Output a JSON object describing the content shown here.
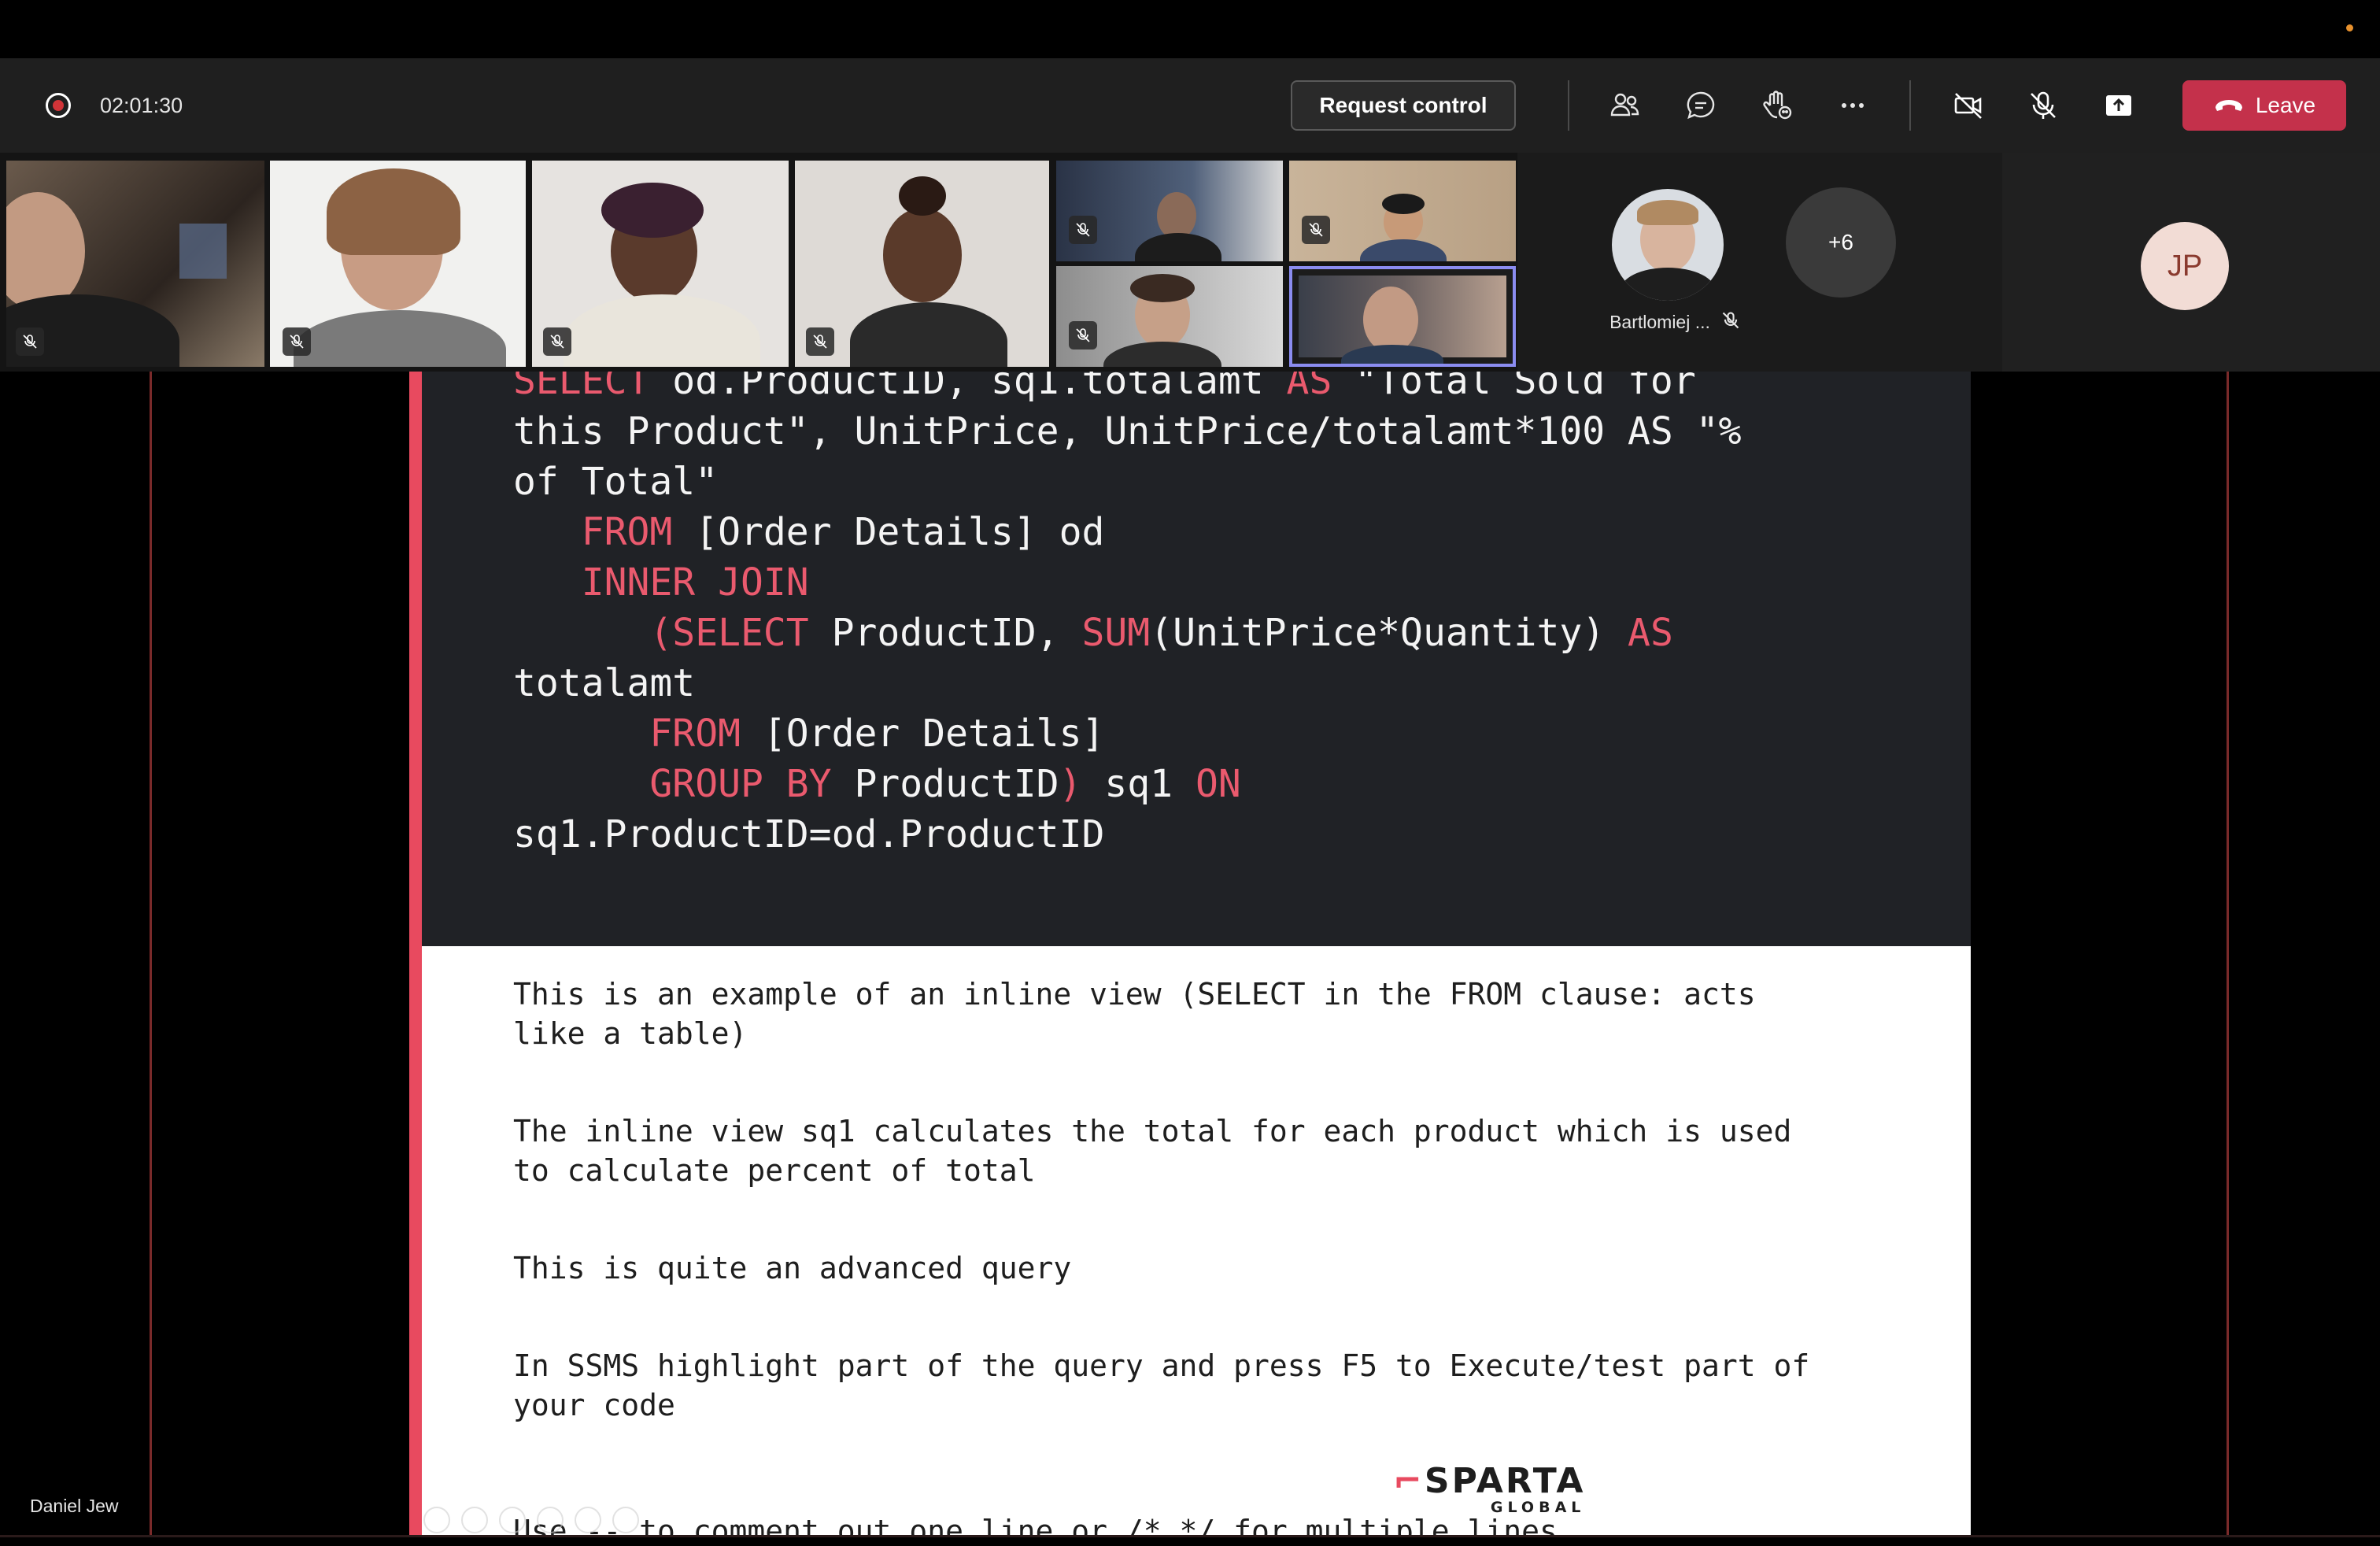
{
  "meeting": {
    "timer": "02:01:30",
    "request_control_label": "Request control",
    "leave_label": "Leave",
    "more_participants": "+6",
    "jp_initials": "JP",
    "bartlomiej_name": "Bartlomiej ...",
    "presenter_name": "Daniel Jew"
  },
  "toolbar_icons": [
    "people-icon",
    "chat-icon",
    "raise-hand-icon",
    "more-options-icon",
    "camera-off-icon",
    "mic-off-icon",
    "share-tray-icon"
  ],
  "colors": {
    "leave": "#c4314b",
    "slide_accent": "#e84a5f",
    "keyword": "#ea5a6e",
    "code_bg": "#202226"
  },
  "slide": {
    "code_lines": [
      [
        {
          "t": "SELECT",
          "k": true
        },
        {
          "t": " od.ProductID, sq1.totalamt "
        },
        {
          "t": "AS",
          "k": true
        },
        {
          "t": " \"Total Sold for"
        }
      ],
      [
        {
          "t": "this Product\", UnitPrice, UnitPrice/totalamt*100 AS \"%"
        }
      ],
      [
        {
          "t": "of Total\""
        }
      ],
      [
        {
          "t": "   "
        },
        {
          "t": "FROM",
          "k": true
        },
        {
          "t": " [Order Details] od"
        }
      ],
      [
        {
          "t": "   "
        },
        {
          "t": "INNER JOIN",
          "k": true
        }
      ],
      [
        {
          "t": "      "
        },
        {
          "t": "(SELECT",
          "k": true
        },
        {
          "t": " ProductID, "
        },
        {
          "t": "SUM",
          "k": true
        },
        {
          "t": "(UnitPrice*Quantity) "
        },
        {
          "t": "AS",
          "k": true
        }
      ],
      [
        {
          "t": "totalamt"
        }
      ],
      [
        {
          "t": "      "
        },
        {
          "t": "FROM",
          "k": true
        },
        {
          "t": " [Order Details]"
        }
      ],
      [
        {
          "t": "      "
        },
        {
          "t": "GROUP BY",
          "k": true
        },
        {
          "t": " ProductID"
        },
        {
          "t": ")",
          "k": true
        },
        {
          "t": " sq1 "
        },
        {
          "t": "ON",
          "k": true
        }
      ],
      [
        {
          "t": "sq1.ProductID=od.ProductID"
        }
      ]
    ],
    "notes": [
      "This is an example of an inline view (SELECT in the FROM clause: acts\nlike a table)",
      "The inline view sq1 calculates the total for each product which is used\nto calculate percent of total",
      "This is quite an advanced query",
      "In SSMS highlight part of the query and press F5 to Execute/test part of\nyour code",
      "Use -- to comment out one line or /* */ for multiple lines"
    ],
    "logo_top": "SPARTA",
    "logo_bottom": "GLOBAL"
  }
}
